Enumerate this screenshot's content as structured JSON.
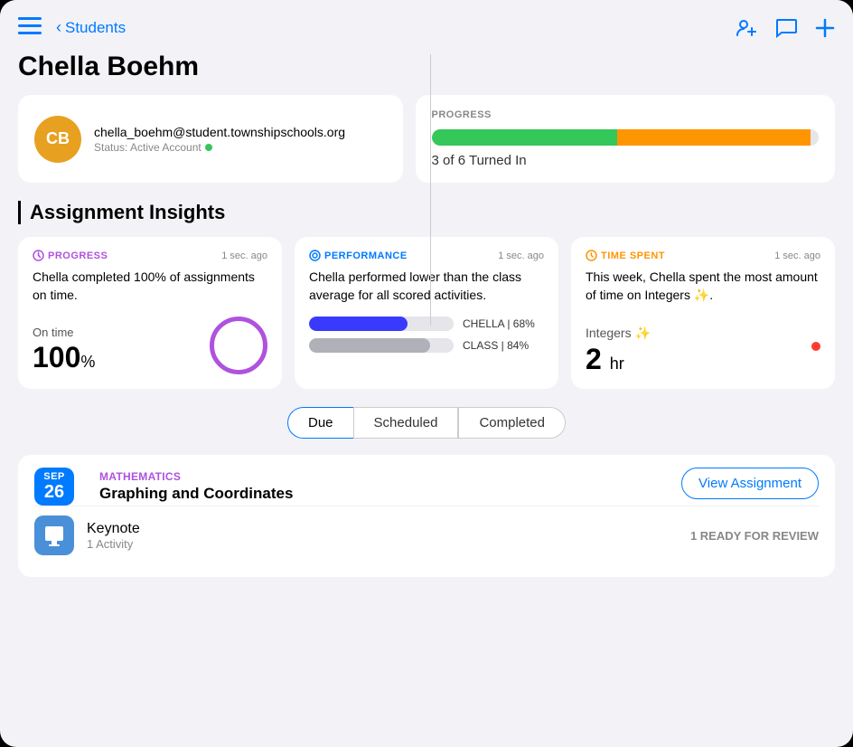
{
  "app": {
    "back_label": "Students",
    "page_title": "Chella Boehm"
  },
  "profile": {
    "initials": "CB",
    "email": "chella_boehm@student.townshipschools.org",
    "status_label": "Status: Active Account",
    "status_color": "#34c759"
  },
  "progress": {
    "section_label": "PROGRESS",
    "bar_green_pct": 48,
    "bar_orange_pct": 50,
    "summary": "3 of 6 Turned In"
  },
  "insights": {
    "section_title": "Assignment Insights",
    "cards": [
      {
        "type": "PROGRESS",
        "type_icon": "⟳",
        "timestamp": "1 sec. ago",
        "description": "Chella completed 100% of assignments on time.",
        "stat_label": "On time",
        "stat_value": "100",
        "stat_unit": "%",
        "circle": true
      },
      {
        "type": "PERFORMANCE",
        "type_icon": "◎",
        "timestamp": "1 sec. ago",
        "description": "Chella performed lower than the class average for all scored activities.",
        "chella_label": "CHELLA",
        "chella_pct": "68%",
        "chella_bar_width": 68,
        "class_label": "CLASS",
        "class_pct": "84%",
        "class_bar_width": 84
      },
      {
        "type": "TIME SPENT",
        "type_icon": "⏱",
        "timestamp": "1 sec. ago",
        "description": "This week, Chella spent the most amount of time on Integers ✨.",
        "subject": "Integers ✨",
        "time_value": "2",
        "time_unit": "hr"
      }
    ]
  },
  "filter_tabs": {
    "tabs": [
      "Due",
      "Scheduled",
      "Completed"
    ],
    "active": "Due"
  },
  "assignments": [
    {
      "date_month": "SEP",
      "date_day": "26",
      "subject": "MATHEMATICS",
      "name": "Graphing and Coordinates",
      "view_btn_label": "View Assignment",
      "activities": [
        {
          "icon_type": "keynote",
          "name": "Keynote",
          "count_label": "1 Activity",
          "status": "1 READY FOR REVIEW"
        }
      ]
    }
  ],
  "icons": {
    "sidebar_toggle": "⊞",
    "person_add": "👤",
    "message": "💬",
    "plus": "+"
  }
}
